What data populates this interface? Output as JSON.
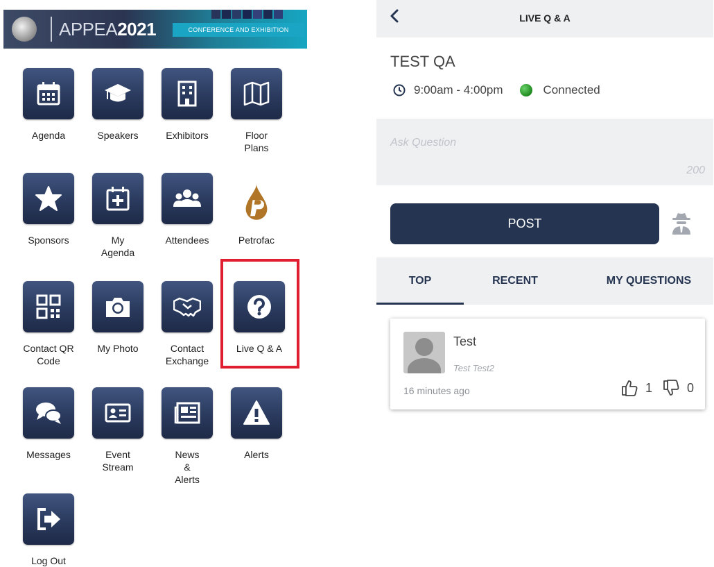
{
  "banner": {
    "brand_prefix": "APPEA",
    "brand_year": "2021",
    "tagline": "CONFERENCE AND EXHIBITION"
  },
  "menu": [
    {
      "label": "Agenda",
      "icon": "calendar-icon"
    },
    {
      "label": "Speakers",
      "icon": "graduation-cap-icon"
    },
    {
      "label": "Exhibitors",
      "icon": "building-icon"
    },
    {
      "label": "Floor Plans",
      "icon": "map-icon"
    },
    {
      "label": "Sponsors",
      "icon": "star-icon"
    },
    {
      "label": "My Agenda",
      "icon": "calendar-plus-icon"
    },
    {
      "label": "Attendees",
      "icon": "users-icon"
    },
    {
      "label": "Petrofac",
      "icon": "petrofac-logo"
    },
    {
      "label": "Contact QR Code",
      "icon": "qr-code-icon"
    },
    {
      "label": "My Photo",
      "icon": "camera-icon"
    },
    {
      "label": "Contact Exchange",
      "icon": "handshake-icon"
    },
    {
      "label": "Live Q & A",
      "icon": "question-icon"
    },
    {
      "label": "Messages",
      "icon": "chat-bubbles-icon"
    },
    {
      "label": "Event Stream",
      "icon": "id-card-icon"
    },
    {
      "label": "News & Alerts",
      "icon": "newspaper-icon"
    },
    {
      "label": "Alerts",
      "icon": "warning-icon"
    },
    {
      "label": "Log Out",
      "icon": "logout-icon"
    }
  ],
  "qa": {
    "header_title": "LIVE Q & A",
    "session_title": "TEST QA",
    "time": "9:00am - 4:00pm",
    "status": "Connected",
    "ask_placeholder": "Ask Question",
    "char_limit": "200",
    "post_label": "POST",
    "tabs": [
      "TOP",
      "RECENT",
      "MY QUESTIONS"
    ],
    "active_tab": "TOP",
    "questions": [
      {
        "name": "Test",
        "text": "Test Test2",
        "time_ago": "16 minutes ago",
        "likes": "1",
        "dislikes": "0"
      }
    ]
  },
  "colors": {
    "tile_navy": "#2a3a5e",
    "post_button": "#253551",
    "highlight_red": "#e01e2f",
    "status_green": "#1e8a1e"
  }
}
